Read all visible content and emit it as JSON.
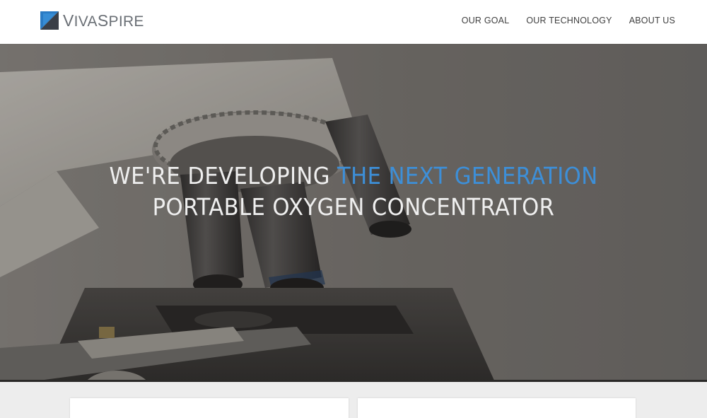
{
  "brand": {
    "name_v": "V",
    "name_iva": "IVA",
    "name_s": "S",
    "name_pire": "PIRE"
  },
  "nav": {
    "items": [
      {
        "label": "OUR GOAL"
      },
      {
        "label": "OUR TECHNOLOGY"
      },
      {
        "label": "ABOUT US"
      }
    ]
  },
  "hero": {
    "headline_part1": "WE'RE DEVELOPING ",
    "headline_accent": "THE NEXT GENERATION",
    "headline_line2": "PORTABLE OXYGEN CONCENTRATOR",
    "accent_color": "#3d8fd8"
  },
  "colors": {
    "logo_blue": "#2a7bc4",
    "logo_dark": "#3a3f47"
  }
}
